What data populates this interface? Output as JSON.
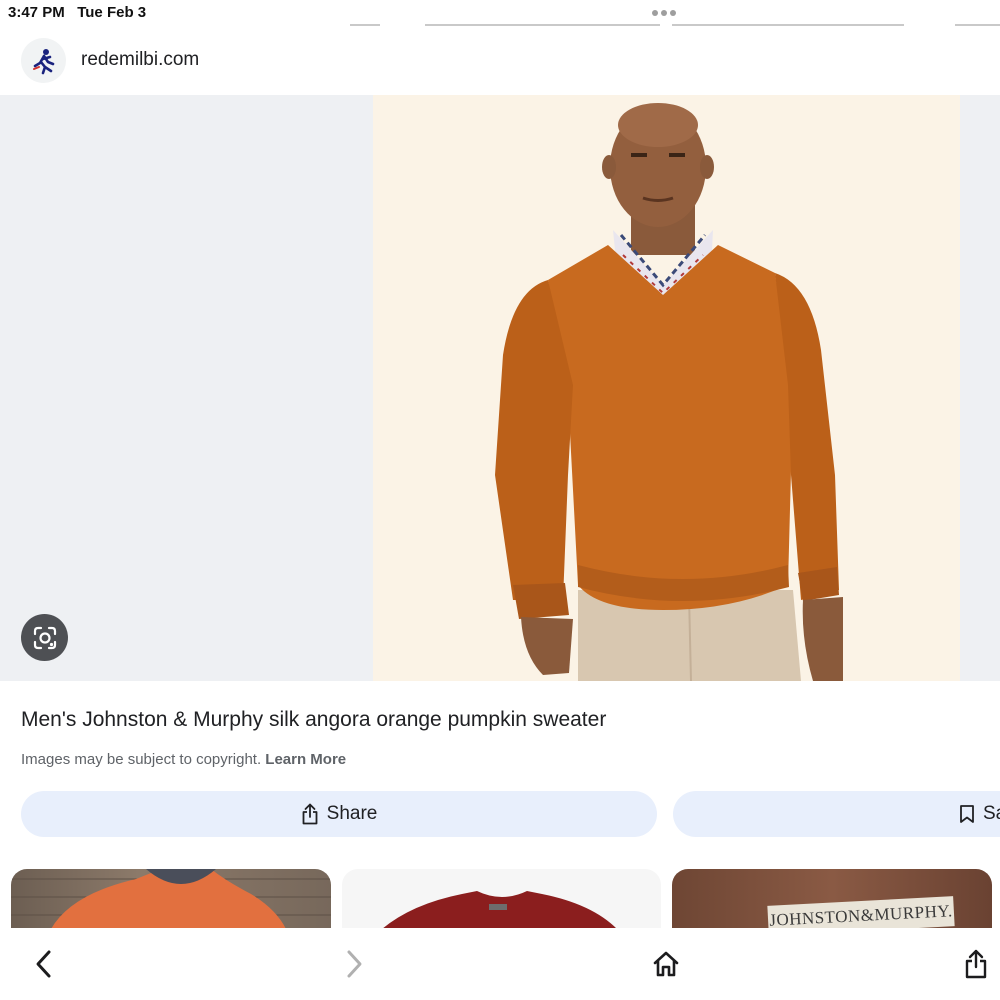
{
  "status_bar": {
    "time": "3:47 PM",
    "date": "Tue Feb 3"
  },
  "source": {
    "domain": "redemilbi.com",
    "favicon_icon": "running-figure-icon"
  },
  "viewer": {
    "image_subject": "man-in-orange-v-neck-sweater",
    "lens_icon": "google-lens-icon"
  },
  "info": {
    "title": "Men's Johnston & Murphy silk angora orange pumpkin sweater",
    "copyright_note": "Images may be subject to copyright.",
    "learn_more": "Learn More"
  },
  "actions": {
    "share_label": "Share",
    "share_icon": "share-icon",
    "save_label": "Sa",
    "save_icon": "bookmark-icon"
  },
  "related": {
    "thumbnails": [
      {
        "subject": "orange-sweater-flatlay"
      },
      {
        "subject": "red-sweater"
      },
      {
        "subject": "brown-sweater-label",
        "label_text": "JOHNSTON&MURPHY."
      }
    ]
  },
  "toolbar": {
    "back_icon": "chevron-left-icon",
    "forward_icon": "chevron-right-icon",
    "home_icon": "home-icon",
    "share_icon": "share-icon"
  },
  "colors": {
    "chip_background": "#e8effc",
    "viewer_background": "#eef0f3",
    "image_background": "#fbf3e6",
    "sweater_orange": "#c86a1f",
    "lens_button": "#4e5054"
  }
}
